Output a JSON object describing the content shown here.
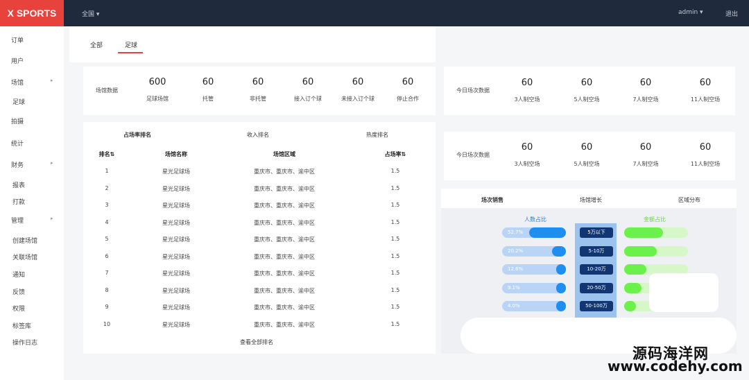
{
  "topbar": {
    "brand": "X SPORTS",
    "region": "全国 ▾",
    "user": "admin ▾",
    "logout": "退出"
  },
  "sidebar": {
    "items": [
      {
        "label": "订单",
        "arrow": ""
      },
      {
        "label": "用户",
        "arrow": ""
      },
      {
        "label": "场馆",
        "arrow": "▸"
      },
      {
        "label": "足球",
        "arrow": ""
      },
      {
        "label": "拍摄",
        "arrow": ""
      },
      {
        "label": "统计",
        "arrow": ""
      },
      {
        "label": "财务",
        "arrow": "▸"
      },
      {
        "label": "报表",
        "arrow": ""
      },
      {
        "label": "打款",
        "arrow": ""
      },
      {
        "label": "管理",
        "arrow": "▸"
      },
      {
        "label": "创建场馆",
        "arrow": ""
      },
      {
        "label": "关联场馆",
        "arrow": ""
      },
      {
        "label": "通知",
        "arrow": ""
      },
      {
        "label": "反馈",
        "arrow": ""
      },
      {
        "label": "权限",
        "arrow": ""
      },
      {
        "label": "标签库",
        "arrow": ""
      },
      {
        "label": "操作日志",
        "arrow": ""
      }
    ]
  },
  "tabs": [
    "全部",
    "足球"
  ],
  "venue_stats": {
    "row_label": "场馆数据",
    "items": [
      {
        "value": "600",
        "label": "足球场馆"
      },
      {
        "value": "60",
        "label": "托管"
      },
      {
        "value": "60",
        "label": "非托管"
      },
      {
        "value": "60",
        "label": "接入订个球"
      },
      {
        "value": "60",
        "label": "未接入订个球"
      },
      {
        "value": "60",
        "label": "停止合作"
      }
    ]
  },
  "today_stats": [
    {
      "row_label": "今日场次数据",
      "items": [
        {
          "value": "60",
          "label": "3人制空场"
        },
        {
          "value": "60",
          "label": "5人制空场"
        },
        {
          "value": "60",
          "label": "7人制空场"
        },
        {
          "value": "60",
          "label": "11人制空场"
        }
      ]
    },
    {
      "row_label": "今日场次数据",
      "items": [
        {
          "value": "60",
          "label": "3人制空场"
        },
        {
          "value": "60",
          "label": "5人制空场"
        },
        {
          "value": "60",
          "label": "7人制空场"
        },
        {
          "value": "60",
          "label": "11人制空场"
        }
      ]
    }
  ],
  "ranking": {
    "tabs": [
      "占场率排名",
      "收入排名",
      "热度排名"
    ],
    "headers": [
      "排名⇅",
      "场馆名称",
      "场馆区域",
      "占场率⇅"
    ],
    "rows": [
      [
        "1",
        "星光足球场",
        "重庆市、重庆市、渝中区",
        "1.5"
      ],
      [
        "2",
        "星光足球场",
        "重庆市、重庆市、渝中区",
        "1.5"
      ],
      [
        "3",
        "星光足球场",
        "重庆市、重庆市、渝中区",
        "1.5"
      ],
      [
        "4",
        "星光足球场",
        "重庆市、重庆市、渝中区",
        "1.5"
      ],
      [
        "5",
        "星光足球场",
        "重庆市、重庆市、渝中区",
        "1.5"
      ],
      [
        "6",
        "星光足球场",
        "重庆市、重庆市、渝中区",
        "1.5"
      ],
      [
        "7",
        "星光足球场",
        "重庆市、重庆市、渝中区",
        "1.5"
      ],
      [
        "8",
        "星光足球场",
        "重庆市、重庆市、渝中区",
        "1.5"
      ],
      [
        "9",
        "星光足球场",
        "重庆市、重庆市、渝中区",
        "1.5"
      ],
      [
        "10",
        "星光足球场",
        "重庆市、重庆市、渝中区",
        "1.5"
      ]
    ],
    "more": "查看全部排名"
  },
  "sales": {
    "tabs": [
      "场次销售",
      "场馆增长",
      "区域分布"
    ],
    "left_title": "人数占比",
    "right_title": "金额占比",
    "left_color": "#1e8ff0",
    "right_color": "#6cf04c",
    "rows": [
      {
        "band": "5万以下",
        "people_pct": 0.527,
        "people_label": "52.7%",
        "amount_pct": 0.45
      },
      {
        "band": "5-10万",
        "people_pct": 0.202,
        "people_label": "20.2%",
        "amount_pct": 0.38
      },
      {
        "band": "10-20万",
        "people_pct": 0.126,
        "people_label": "12.6%",
        "amount_pct": 0.26
      },
      {
        "band": "20-50万",
        "people_pct": 0.091,
        "people_label": "9.1%",
        "amount_pct": 0.2
      },
      {
        "band": "50-100万",
        "people_pct": 0.04,
        "people_label": "4.0%",
        "amount_pct": 0.14
      }
    ]
  },
  "watermark": {
    "line1": "源码海洋网",
    "line2": "www.codehy.com"
  }
}
